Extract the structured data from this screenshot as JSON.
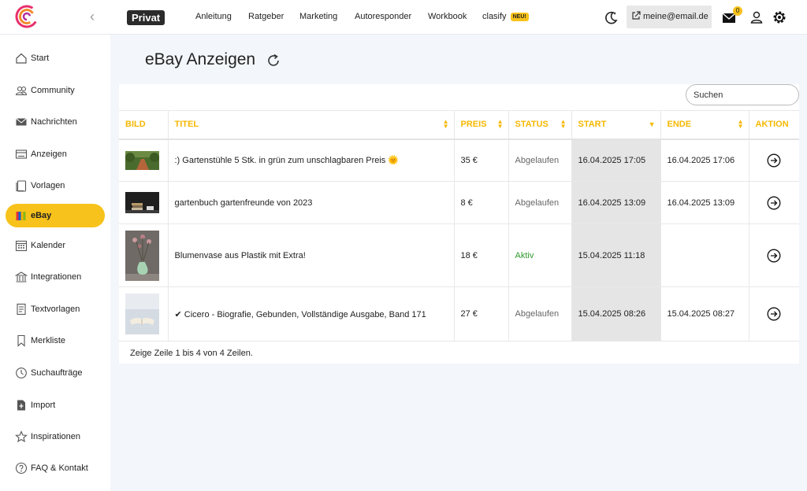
{
  "header": {
    "badge": "Privat",
    "nav": [
      "Anleitung",
      "Ratgeber",
      "Marketing",
      "Autoresponder",
      "Workbook",
      "clasify"
    ],
    "new_badge": "NEU!",
    "email": "meine@email.de",
    "mail_count": "0",
    "accent": "#f7c21b"
  },
  "sidebar": {
    "items": [
      {
        "label": "Start",
        "icon": "home-icon"
      },
      {
        "label": "Community",
        "icon": "users-icon"
      },
      {
        "label": "Nachrichten",
        "icon": "mail-icon"
      },
      {
        "label": "Anzeigen",
        "icon": "ads-icon"
      },
      {
        "label": "Vorlagen",
        "icon": "template-icon"
      },
      {
        "label": "eBay",
        "icon": "ebay-icon"
      },
      {
        "label": "Kalender",
        "icon": "calendar-icon"
      },
      {
        "label": "Integrationen",
        "icon": "integrations-icon"
      },
      {
        "label": "Textvorlagen",
        "icon": "text-template-icon"
      },
      {
        "label": "Merkliste",
        "icon": "bookmark-icon"
      },
      {
        "label": "Suchaufträge",
        "icon": "search-order-icon"
      },
      {
        "label": "Import",
        "icon": "import-icon"
      },
      {
        "label": "Inspirationen",
        "icon": "star-icon"
      },
      {
        "label": "FAQ & Kontakt",
        "icon": "help-icon"
      }
    ],
    "active": "eBay"
  },
  "main": {
    "title": "eBay Anzeigen",
    "search_placeholder": "Suchen",
    "columns": [
      "BILD",
      "TITEL",
      "PREIS",
      "STATUS",
      "START",
      "ENDE",
      "AKTION"
    ],
    "rows": [
      {
        "image": "garden-path-photo",
        "title": ":) Gartenstühle 5 Stk. in grün zum unschlagbaren Preis 🌞",
        "price": "35 €",
        "status": "Abgelaufen",
        "start": "16.04.2025 17:05",
        "end": "16.04.2025 17:06"
      },
      {
        "image": "books-on-table-photo",
        "title": "gartenbuch gartenfreunde von 2023",
        "price": "8 €",
        "status": "Abgelaufen",
        "start": "16.04.2025 13:09",
        "end": "16.04.2025 13:09"
      },
      {
        "image": "vase-with-flowers-photo",
        "title": "Blumenvase aus Plastik mit Extra!",
        "price": "18 €",
        "status": "Aktiv",
        "start": "15.04.2025 11:18",
        "end": ""
      },
      {
        "image": "open-book-photo",
        "title": "✔ Cicero - Biografie, Gebunden, Vollständige Ausgabe, Band 171",
        "price": "27 €",
        "status": "Abgelaufen",
        "start": "15.04.2025 08:26",
        "end": "15.04.2025 08:27"
      }
    ],
    "footer": "Zeige Zeile 1 bis 4 von 4 Zeilen."
  }
}
